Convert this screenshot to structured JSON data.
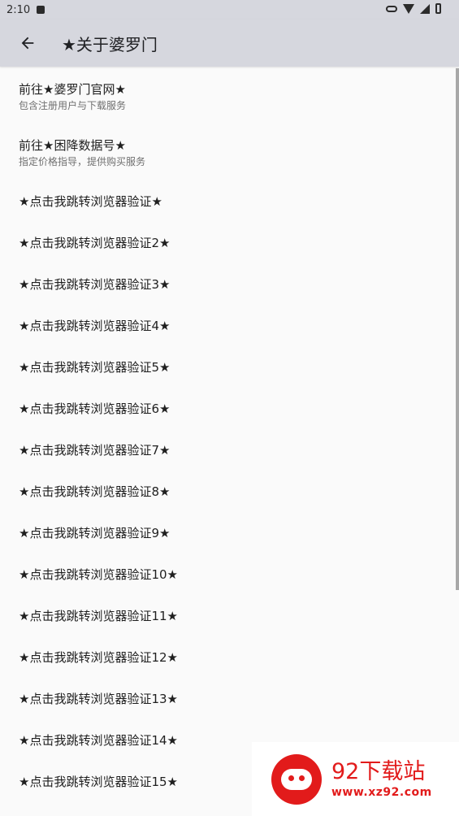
{
  "status_bar": {
    "time": "2:10"
  },
  "appbar": {
    "title": "★关于婆罗门"
  },
  "items": [
    {
      "title": "前往★婆罗门官网★",
      "subtitle": "包含注册用户与下载服务"
    },
    {
      "title": "前往★困降数据号★",
      "subtitle": "指定价格指导，提供购买服务"
    },
    {
      "title": "★点击我跳转浏览器验证★"
    },
    {
      "title": "★点击我跳转浏览器验证2★"
    },
    {
      "title": "★点击我跳转浏览器验证3★"
    },
    {
      "title": "★点击我跳转浏览器验证4★"
    },
    {
      "title": "★点击我跳转浏览器验证5★"
    },
    {
      "title": "★点击我跳转浏览器验证6★"
    },
    {
      "title": "★点击我跳转浏览器验证7★"
    },
    {
      "title": "★点击我跳转浏览器验证8★"
    },
    {
      "title": "★点击我跳转浏览器验证9★"
    },
    {
      "title": "★点击我跳转浏览器验证10★"
    },
    {
      "title": "★点击我跳转浏览器验证11★"
    },
    {
      "title": "★点击我跳转浏览器验证12★"
    },
    {
      "title": "★点击我跳转浏览器验证13★"
    },
    {
      "title": "★点击我跳转浏览器验证14★"
    },
    {
      "title": "★点击我跳转浏览器验证15★"
    }
  ],
  "watermark": {
    "brand": "92下载站",
    "url": "www.xz92.com"
  },
  "colors": {
    "bar": "#d6d7de",
    "watermark": "#e21b1b"
  },
  "icons": {
    "back": "arrow-left-icon",
    "wifi": "wifi-icon",
    "signal": "signal-icon",
    "battery": "battery-icon",
    "vpn": "key-icon"
  }
}
